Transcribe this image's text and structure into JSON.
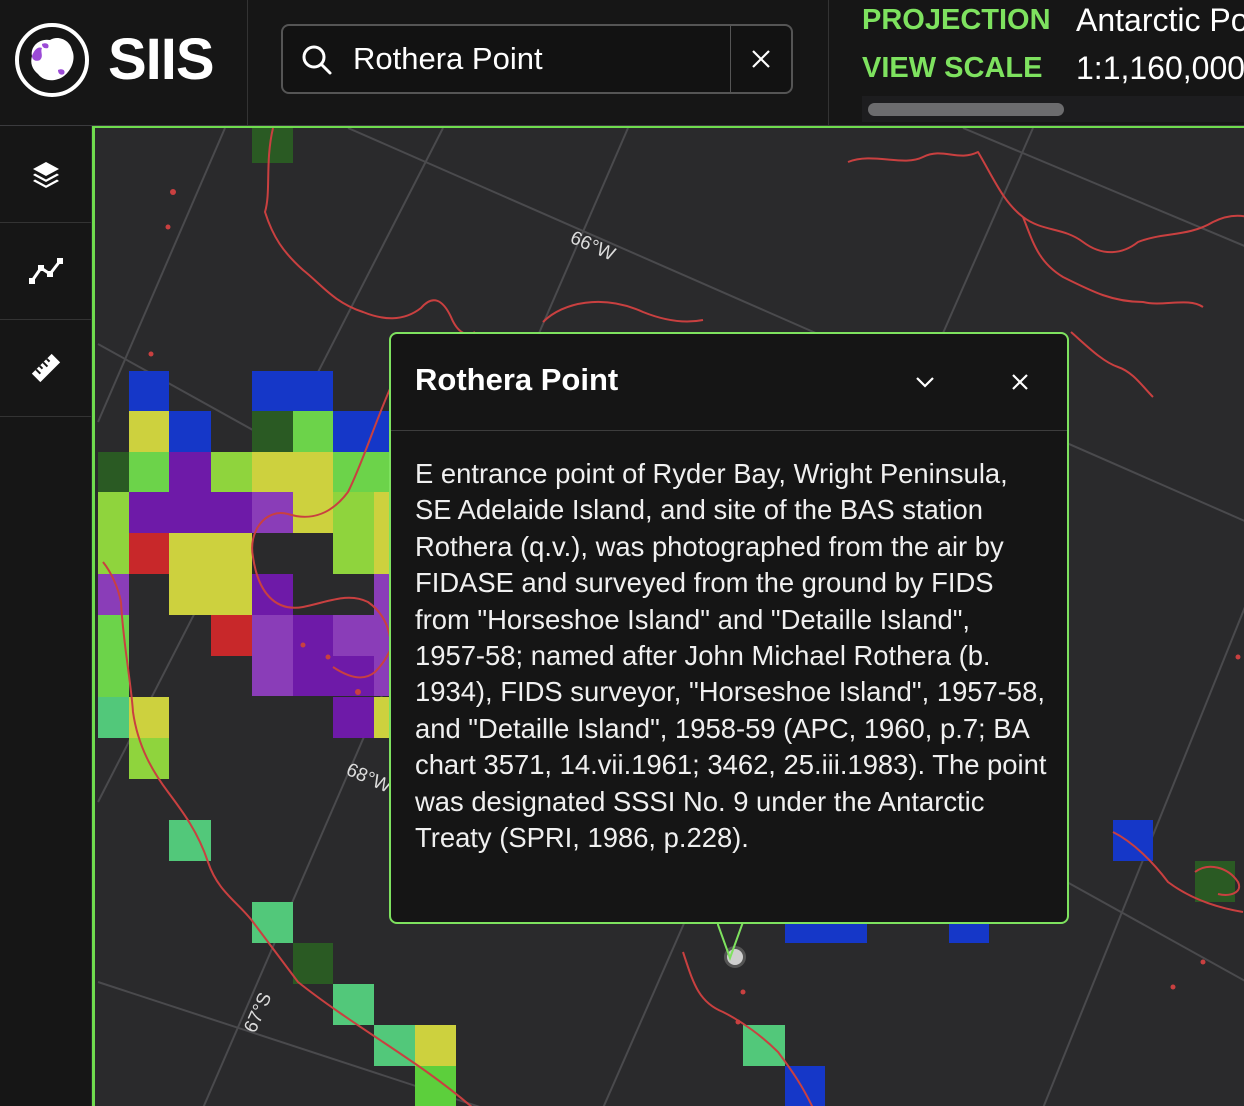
{
  "app": {
    "name": "SIIS",
    "logo_icon": "antarctica-logo-icon"
  },
  "search": {
    "value": "Rothera Point",
    "placeholder": "",
    "search_icon": "search-icon",
    "clear_icon": "close-icon"
  },
  "map_info": {
    "projection_label": "PROJECTION",
    "projection_value": "Antarctic Polar Stereographic",
    "view_scale_label": "VIEW SCALE",
    "view_scale_value": "1:1,160,000"
  },
  "toolbar": [
    {
      "icon": "layers-icon"
    },
    {
      "icon": "route-icon"
    },
    {
      "icon": "ruler-icon"
    }
  ],
  "map": {
    "graticule_labels": [
      "66°W",
      "68°W",
      "67°S"
    ],
    "colors": {
      "frame": "#6fdc4e",
      "coastline": "#c94040",
      "graticule": "#4a4a4d",
      "background": "#2a2a2c"
    },
    "marker_icon": "location-marker-icon"
  },
  "popup": {
    "title": "Rothera Point",
    "collapse_icon": "chevron-down-icon",
    "close_icon": "close-icon",
    "body": "E entrance point of Ryder Bay, Wright Peninsula, SE Adelaide Island, and site of the BAS station Rothera (q.v.), was photographed from the air by FIDASE and surveyed from the ground by FIDS from \"Horseshoe Island\" and \"Detaille Island\", 1957-58; named after John Michael Rothera (b. 1934), FIDS surveyor, \"Horseshoe Island\", 1957-58, and \"Detaille Island\", 1958-59 (APC, 1960, p.7; BA chart 3571, 14.vii.1961; 3462, 25.iii.1983). The point was designated SSSI No. 9 under the Antarctic Treaty (SPRI, 1986, p.228)."
  }
}
